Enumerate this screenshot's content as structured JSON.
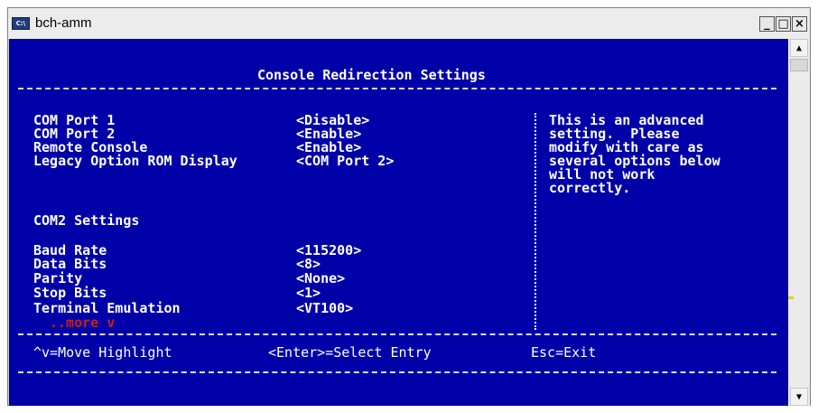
{
  "window": {
    "title": "bch-amm",
    "icon": "console-icon",
    "icon_text": "C:\\",
    "controls": {
      "minimize": "_",
      "maximize": "□",
      "close": "×"
    }
  },
  "bios": {
    "header": "Console Redirection Settings",
    "settings": [
      {
        "label": "COM Port 1",
        "value": "<Disable>"
      },
      {
        "label": "COM Port 2",
        "value": "<Enable>"
      },
      {
        "label": "Remote Console",
        "value": "<Enable>"
      },
      {
        "label": "Legacy Option ROM Display",
        "value": "<COM Port 2>"
      }
    ],
    "section_title": "COM2 Settings",
    "com2_settings": [
      {
        "label": "Baud Rate",
        "value": "<115200>"
      },
      {
        "label": "Data Bits",
        "value": "<8>"
      },
      {
        "label": "Parity",
        "value": "<None>"
      },
      {
        "label": "Stop Bits",
        "value": "<1>"
      },
      {
        "label": "Terminal Emulation",
        "value": "<VT100>"
      }
    ],
    "more": "..more v",
    "help_lines": [
      "This is an advanced",
      "setting.  Please",
      "modify with care as",
      "several options below",
      "will not work",
      "correctly."
    ],
    "footer": {
      "move": "^v=Move Highlight",
      "select": "<Enter>=Select Entry",
      "exit": "Esc=Exit"
    }
  },
  "colors": {
    "console_bg": "#0000a8",
    "text": "#ffffff",
    "more_text": "#c02020",
    "scroll_marker": "#e0d020"
  }
}
